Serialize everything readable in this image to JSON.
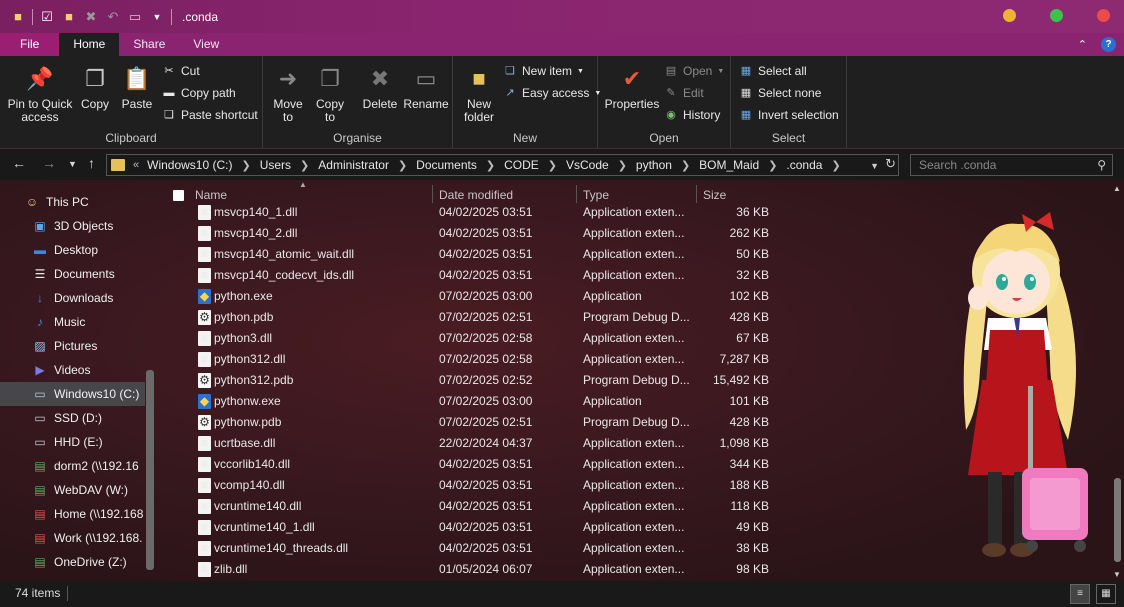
{
  "window": {
    "title": ".conda"
  },
  "ribbon_tabs": [
    "File",
    "Home",
    "Share",
    "View"
  ],
  "ribbon": {
    "clipboard": {
      "label": "Clipboard",
      "pin": "Pin to Quick access",
      "copy": "Copy",
      "paste": "Paste",
      "cut": "Cut",
      "copy_path": "Copy path",
      "paste_shortcut": "Paste shortcut"
    },
    "organise": {
      "label": "Organise",
      "move_to": "Move to",
      "copy_to": "Copy to",
      "delete": "Delete",
      "rename": "Rename"
    },
    "new": {
      "label": "New",
      "new_folder": "New folder",
      "new_item": "New item",
      "easy_access": "Easy access"
    },
    "open": {
      "label": "Open",
      "properties": "Properties",
      "open": "Open",
      "edit": "Edit",
      "history": "History"
    },
    "select": {
      "label": "Select",
      "select_all": "Select all",
      "select_none": "Select none",
      "invert": "Invert selection"
    }
  },
  "address": {
    "crumbs": [
      "Windows10 (C:)",
      "Users",
      "Administrator",
      "Documents",
      "CODE",
      "VsCode",
      "python",
      "BOM_Maid",
      ".conda"
    ],
    "search_placeholder": "Search .conda"
  },
  "sidebar": [
    {
      "label": "This PC",
      "icon": "this-pc-icon",
      "color": "#f2d28a"
    },
    {
      "label": "3D Objects",
      "icon": "3d-objects-icon",
      "color": "#5aa8e8"
    },
    {
      "label": "Desktop",
      "icon": "desktop-icon",
      "color": "#2e8fe0"
    },
    {
      "label": "Documents",
      "icon": "documents-icon",
      "color": "#e8e8e8"
    },
    {
      "label": "Downloads",
      "icon": "downloads-icon",
      "color": "#3a8ee0"
    },
    {
      "label": "Music",
      "icon": "music-icon",
      "color": "#3a8ee0"
    },
    {
      "label": "Pictures",
      "icon": "pictures-icon",
      "color": "#9ac8f0"
    },
    {
      "label": "Videos",
      "icon": "videos-icon",
      "color": "#7a7ae0"
    },
    {
      "label": "Windows10 (C:)",
      "icon": "drive-icon",
      "color": "#bfc8d0"
    },
    {
      "label": "SSD (D:)",
      "icon": "drive-icon",
      "color": "#bfc8d0"
    },
    {
      "label": "HHD (E:)",
      "icon": "drive-icon",
      "color": "#bfc8d0"
    },
    {
      "label": "dorm2 (\\\\192.16",
      "icon": "network-drive-icon",
      "color": "#5ab060"
    },
    {
      "label": "WebDAV (W:)",
      "icon": "network-drive-icon",
      "color": "#5ab060"
    },
    {
      "label": "Home (\\\\192.168",
      "icon": "network-drive-icon",
      "color": "#e05050"
    },
    {
      "label": "Work (\\\\192.168.",
      "icon": "network-drive-icon",
      "color": "#e05050"
    },
    {
      "label": "OneDrive (Z:)",
      "icon": "network-drive-icon",
      "color": "#5ab060"
    }
  ],
  "columns": {
    "name": "Name",
    "date": "Date modified",
    "type": "Type",
    "size": "Size"
  },
  "files": [
    {
      "name": "msvcp140_1.dll",
      "date": "04/02/2025 03:51",
      "type": "Application exten...",
      "size": "36 KB",
      "kind": "dll"
    },
    {
      "name": "msvcp140_2.dll",
      "date": "04/02/2025 03:51",
      "type": "Application exten...",
      "size": "262 KB",
      "kind": "dll"
    },
    {
      "name": "msvcp140_atomic_wait.dll",
      "date": "04/02/2025 03:51",
      "type": "Application exten...",
      "size": "50 KB",
      "kind": "dll"
    },
    {
      "name": "msvcp140_codecvt_ids.dll",
      "date": "04/02/2025 03:51",
      "type": "Application exten...",
      "size": "32 KB",
      "kind": "dll"
    },
    {
      "name": "python.exe",
      "date": "07/02/2025 03:00",
      "type": "Application",
      "size": "102 KB",
      "kind": "exe"
    },
    {
      "name": "python.pdb",
      "date": "07/02/2025 02:51",
      "type": "Program Debug D...",
      "size": "428 KB",
      "kind": "pdb"
    },
    {
      "name": "python3.dll",
      "date": "07/02/2025 02:58",
      "type": "Application exten...",
      "size": "67 KB",
      "kind": "dll"
    },
    {
      "name": "python312.dll",
      "date": "07/02/2025 02:58",
      "type": "Application exten...",
      "size": "7,287 KB",
      "kind": "dll"
    },
    {
      "name": "python312.pdb",
      "date": "07/02/2025 02:52",
      "type": "Program Debug D...",
      "size": "15,492 KB",
      "kind": "pdb"
    },
    {
      "name": "pythonw.exe",
      "date": "07/02/2025 03:00",
      "type": "Application",
      "size": "101 KB",
      "kind": "exe"
    },
    {
      "name": "pythonw.pdb",
      "date": "07/02/2025 02:51",
      "type": "Program Debug D...",
      "size": "428 KB",
      "kind": "pdb"
    },
    {
      "name": "ucrtbase.dll",
      "date": "22/02/2024 04:37",
      "type": "Application exten...",
      "size": "1,098 KB",
      "kind": "dll"
    },
    {
      "name": "vccorlib140.dll",
      "date": "04/02/2025 03:51",
      "type": "Application exten...",
      "size": "344 KB",
      "kind": "dll"
    },
    {
      "name": "vcomp140.dll",
      "date": "04/02/2025 03:51",
      "type": "Application exten...",
      "size": "188 KB",
      "kind": "dll"
    },
    {
      "name": "vcruntime140.dll",
      "date": "04/02/2025 03:51",
      "type": "Application exten...",
      "size": "118 KB",
      "kind": "dll"
    },
    {
      "name": "vcruntime140_1.dll",
      "date": "04/02/2025 03:51",
      "type": "Application exten...",
      "size": "49 KB",
      "kind": "dll"
    },
    {
      "name": "vcruntime140_threads.dll",
      "date": "04/02/2025 03:51",
      "type": "Application exten...",
      "size": "38 KB",
      "kind": "dll"
    },
    {
      "name": "zlib.dll",
      "date": "01/05/2024 06:07",
      "type": "Application exten...",
      "size": "98 KB",
      "kind": "dll"
    }
  ],
  "status": {
    "count": "74 items"
  },
  "colors": {
    "titlebar": "#8a2470",
    "accent": "#9a1f72",
    "selected": "#47474b"
  }
}
